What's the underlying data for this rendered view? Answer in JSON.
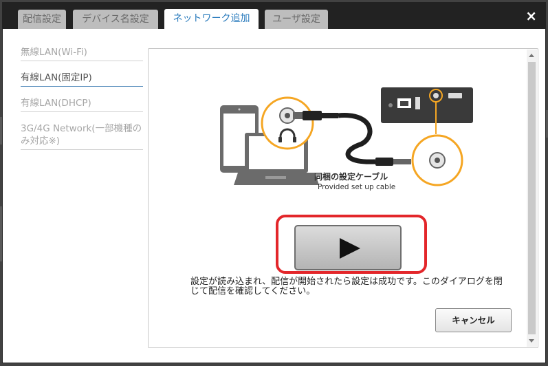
{
  "tabs": [
    {
      "label": "配信設定"
    },
    {
      "label": "デバイス名設定"
    },
    {
      "label": "ネットワーク追加"
    },
    {
      "label": "ユーザ設定"
    }
  ],
  "close_label": "×",
  "sidebar": {
    "items": [
      {
        "label": "無線LAN(Wi-Fi)"
      },
      {
        "label": "有線LAN(固定IP)"
      },
      {
        "label": "有線LAN(DHCP)"
      },
      {
        "label": "3G/4G Network(一部機種のみ対応※)"
      }
    ]
  },
  "illustration": {
    "cable_label_jp": "同梱の設定ケーブル",
    "cable_label_en": "Provided set up cable"
  },
  "message": "設定が読み込まれ、配信が開始されたら設定は成功です。このダイアログを閉じて配信を確認してください。",
  "cancel_label": "キャンセル",
  "colors": {
    "accent": "#2a7bbd",
    "highlight": "#e3262a",
    "jack_ring": "#f5a623"
  }
}
